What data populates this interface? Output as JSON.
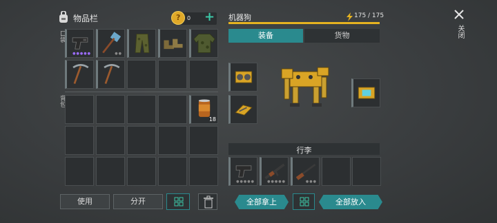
{
  "inventory": {
    "title": "物品栏",
    "coins": "0",
    "add_symbol": "+",
    "pocket_label": "口袋",
    "backpack_label": "背包",
    "pocket_items": [
      {
        "name": "pistol",
        "dots": "●●●●●"
      },
      {
        "name": "sledgehammer",
        "dots": "●●"
      },
      {
        "name": "camo-pants",
        "dots": ""
      },
      {
        "name": "boots",
        "dots": ""
      },
      {
        "name": "camo-jacket",
        "dots": ""
      },
      {
        "name": "pickaxe",
        "dots": ""
      },
      {
        "name": "pickaxe",
        "dots": ""
      }
    ],
    "backpack_items": [
      {
        "name": "canned-food",
        "count": "18"
      }
    ],
    "use_label": "使用",
    "split_label": "分开"
  },
  "companion": {
    "name": "机器狗",
    "health": "175 / 175",
    "health_fraction": 1.0,
    "tabs": [
      "装备",
      "货物"
    ],
    "active_tab": 0,
    "luggage_label": "行李",
    "luggage_items": [
      {
        "name": "pistol",
        "dots": "●●●●●"
      },
      {
        "name": "assault-rifle",
        "dots": "●●●●●"
      },
      {
        "name": "rifle",
        "dots": "●●●"
      }
    ],
    "take_all_label": "全部拿上",
    "put_all_label": "全部放入"
  },
  "close_label": "关闭",
  "colors": {
    "accent": "#2a8a8e",
    "yellow": "#e6b320",
    "dots_purple": "#9b6cff",
    "dots_green": "#8ed07a"
  }
}
